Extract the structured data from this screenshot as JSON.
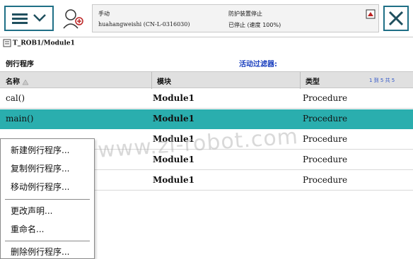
{
  "status": {
    "mode": "手动",
    "host": "huahangweishi (CN-L-0316030)",
    "guard_state": "防护装置停止",
    "run_state": "已停止 (速度 100%)"
  },
  "breadcrumb": "T_ROB1/Module1",
  "section": {
    "title": "例行程序",
    "filter_label": "活动过滤器:"
  },
  "table": {
    "columns": [
      "名称",
      "模块",
      "类型"
    ],
    "page_info": "1 到 5 共 5",
    "rows": [
      {
        "name": "cal()",
        "module": "Module1",
        "type": "Procedure",
        "selected": false
      },
      {
        "name": "main()",
        "module": "Module1",
        "type": "Procedure",
        "selected": true
      },
      {
        "name": "",
        "module": "Module1",
        "type": "Procedure",
        "selected": false
      },
      {
        "name": "",
        "module": "Module1",
        "type": "Procedure",
        "selected": false
      },
      {
        "name": "",
        "module": "Module1",
        "type": "Procedure",
        "selected": false
      }
    ]
  },
  "context_menu": {
    "items": [
      "新建例行程序...",
      "复制例行程序...",
      "移动例行程序...",
      "更改声明...",
      "重命名...",
      "删除例行程序..."
    ]
  },
  "watermark": "www.zl-robot.com",
  "colors": {
    "accent": "#1f6f86",
    "selection": "#2aaeae",
    "filter_text": "#1a3fbf"
  },
  "icons": {
    "menu": "menu-icon",
    "operator": "operator-window-icon",
    "close": "close-icon",
    "program": "program-file-icon",
    "sort": "sort-ascending-icon"
  }
}
